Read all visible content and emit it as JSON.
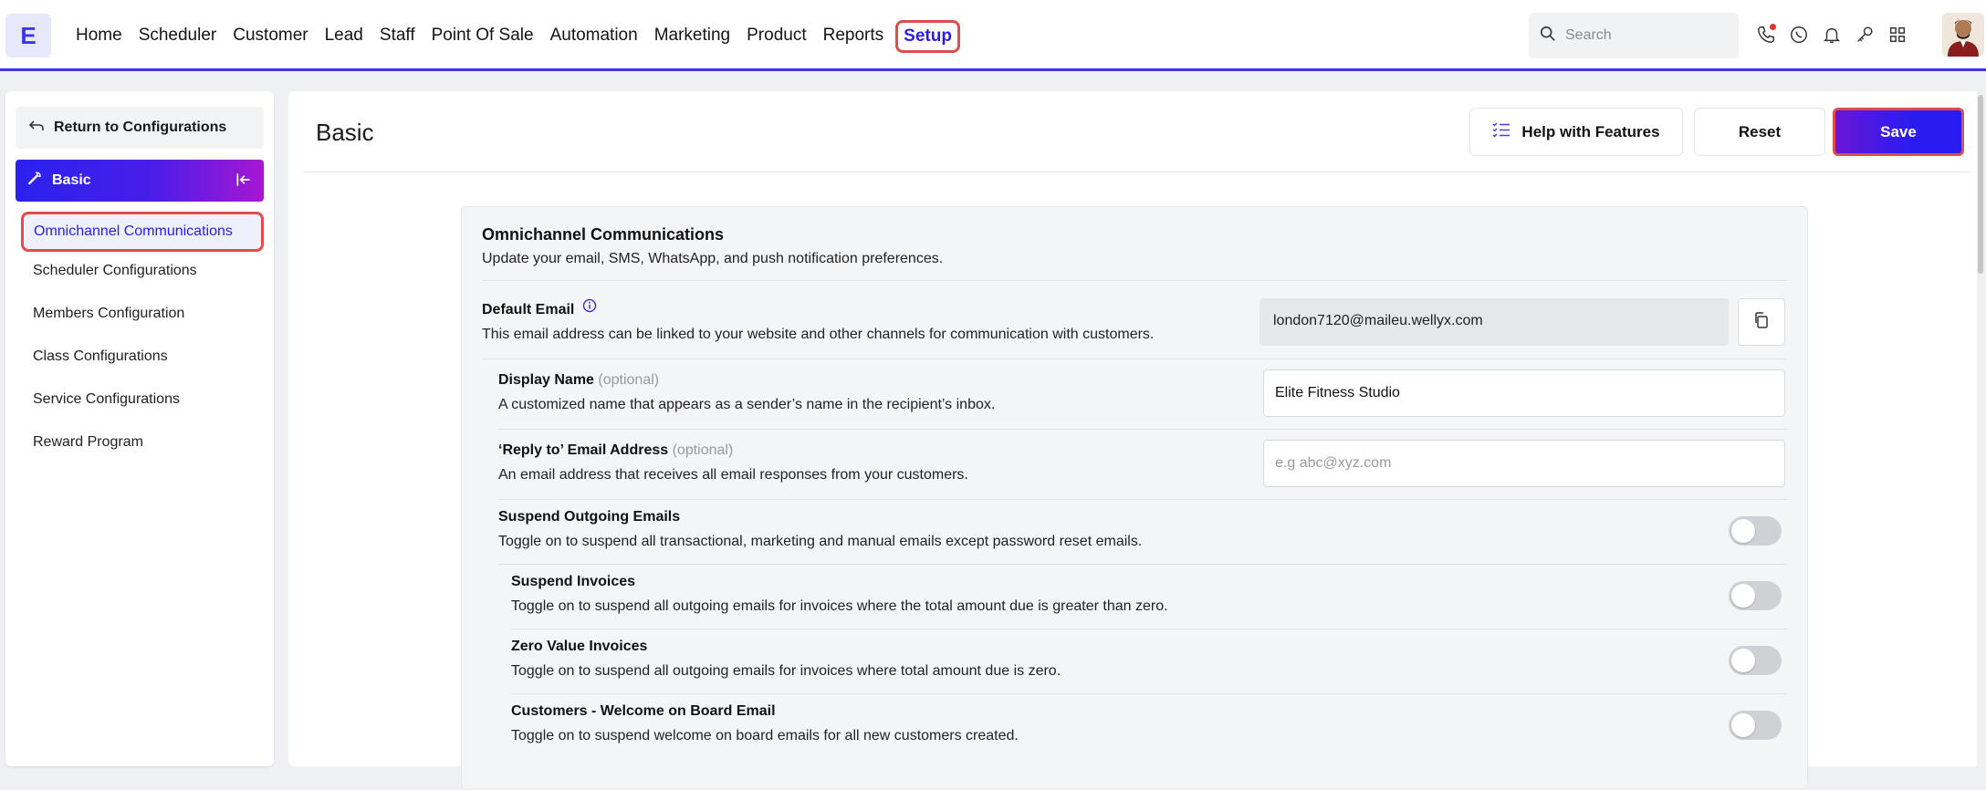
{
  "brand": {
    "logo_letter": "E",
    "accent": "#3b35ee",
    "highlight": "#e04b4b"
  },
  "nav": {
    "items": [
      "Home",
      "Scheduler",
      "Customer",
      "Lead",
      "Staff",
      "Point Of Sale",
      "Automation",
      "Marketing",
      "Product",
      "Reports"
    ],
    "active": "Setup"
  },
  "search": {
    "placeholder": "Search"
  },
  "top_icons": [
    "phone-icon",
    "whatsapp-icon",
    "bell-icon",
    "key-icon",
    "apps-grid-icon"
  ],
  "sidebar": {
    "return_label": "Return to Configurations",
    "section_label": "Basic",
    "items": [
      "Omnichannel Communications",
      "Scheduler Configurations",
      "Members Configuration",
      "Class Configurations",
      "Service Configurations",
      "Reward Program"
    ],
    "active_index": 0
  },
  "header": {
    "title": "Basic",
    "help_label": "Help with Features",
    "reset_label": "Reset",
    "save_label": "Save"
  },
  "card": {
    "title": "Omnichannel Communications",
    "subtitle": "Update your email, SMS, WhatsApp, and push notification preferences.",
    "default_email": {
      "label": "Default Email",
      "desc": "This email address can be linked to your website and other channels for communication with customers.",
      "value": "london7120@maileu.wellyx.com"
    },
    "display_name": {
      "label": "Display Name",
      "optional": "(optional)",
      "desc": "A customized name that appears as a sender’s name in the recipient’s inbox.",
      "value": "Elite Fitness Studio"
    },
    "reply_to": {
      "label": "‘Reply to’ Email Address",
      "optional": "(optional)",
      "desc": "An email address that receives all email responses from your customers.",
      "placeholder": "e.g abc@xyz.com"
    },
    "toggles": [
      {
        "label": "Suspend Outgoing Emails",
        "desc": "Toggle on to suspend all transactional, marketing and manual emails except password reset emails.",
        "on": false
      },
      {
        "label": "Suspend Invoices",
        "desc": "Toggle on to suspend all outgoing emails for invoices where the total amount due is greater than zero.",
        "on": false
      },
      {
        "label": "Zero Value Invoices",
        "desc": "Toggle on to suspend all outgoing emails for invoices where total amount due is zero.",
        "on": false
      },
      {
        "label": "Customers - Welcome on Board Email",
        "desc": "Toggle on to suspend welcome on board emails for all new customers created.",
        "on": false
      }
    ]
  }
}
